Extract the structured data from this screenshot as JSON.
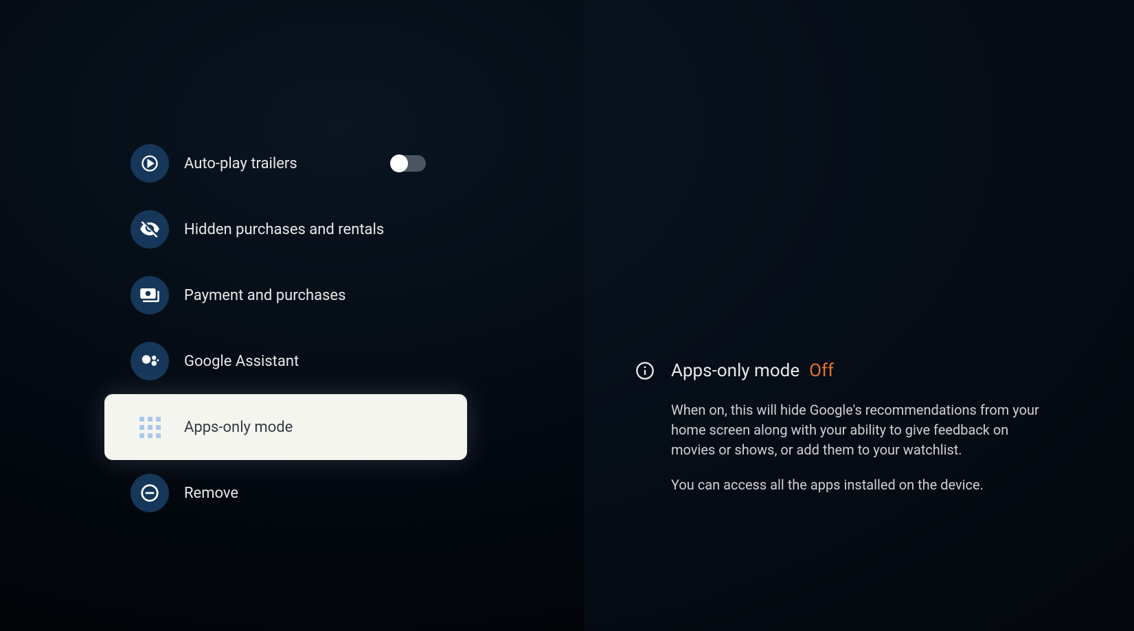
{
  "menu": {
    "items": [
      {
        "id": "auto-play-trailers",
        "label": "Auto-play trailers",
        "toggle": false
      },
      {
        "id": "hidden-purchases",
        "label": "Hidden purchases and rentals"
      },
      {
        "id": "payment-purchases",
        "label": "Payment and purchases"
      },
      {
        "id": "google-assistant",
        "label": "Google Assistant"
      },
      {
        "id": "apps-only-mode",
        "label": "Apps-only mode",
        "selected": true
      },
      {
        "id": "remove",
        "label": "Remove"
      }
    ]
  },
  "detail": {
    "title": "Apps-only mode",
    "status": "Off",
    "paragraph1": "When on, this will hide Google's recommendations from your home screen along with your ability to give feedback on movies or shows, or add them to your watchlist.",
    "paragraph2": "You can access all the apps installed on the device."
  }
}
